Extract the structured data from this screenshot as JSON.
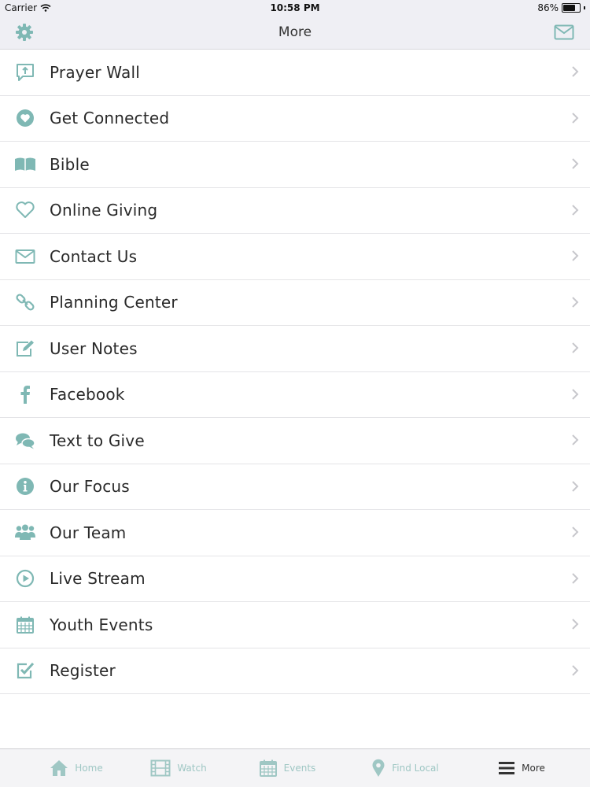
{
  "status_bar": {
    "carrier": "Carrier",
    "time": "10:58 PM",
    "battery": "86%",
    "battery_level": 0.86
  },
  "nav": {
    "title": "More",
    "left_icon": "gear-icon",
    "right_icon": "mail-icon"
  },
  "colors": {
    "accent": "#7fb8b4",
    "active_tab": "#333333",
    "inactive_tab": "#9fc7c4"
  },
  "menu": {
    "items": [
      {
        "label": "Prayer Wall",
        "icon": "prayer-wall-icon"
      },
      {
        "label": "Get Connected",
        "icon": "heart-circle-icon"
      },
      {
        "label": "Bible",
        "icon": "book-icon"
      },
      {
        "label": "Online Giving",
        "icon": "heart-outline-icon"
      },
      {
        "label": "Contact Us",
        "icon": "envelope-icon"
      },
      {
        "label": "Planning Center",
        "icon": "link-icon"
      },
      {
        "label": "User Notes",
        "icon": "edit-icon"
      },
      {
        "label": "Facebook",
        "icon": "facebook-icon"
      },
      {
        "label": "Text to Give",
        "icon": "chat-icon"
      },
      {
        "label": "Our Focus",
        "icon": "info-icon"
      },
      {
        "label": "Our Team",
        "icon": "team-icon"
      },
      {
        "label": "Live Stream",
        "icon": "play-icon"
      },
      {
        "label": "Youth Events",
        "icon": "calendar-icon"
      },
      {
        "label": "Register",
        "icon": "checkbox-icon"
      }
    ]
  },
  "tabs": [
    {
      "label": "Home",
      "icon": "home-icon",
      "active": false
    },
    {
      "label": "Watch",
      "icon": "film-icon",
      "active": false
    },
    {
      "label": "Events",
      "icon": "calendar-icon",
      "active": false
    },
    {
      "label": "Find Local",
      "icon": "location-pin-icon",
      "active": false
    },
    {
      "label": "More",
      "icon": "menu-icon",
      "active": true
    }
  ]
}
